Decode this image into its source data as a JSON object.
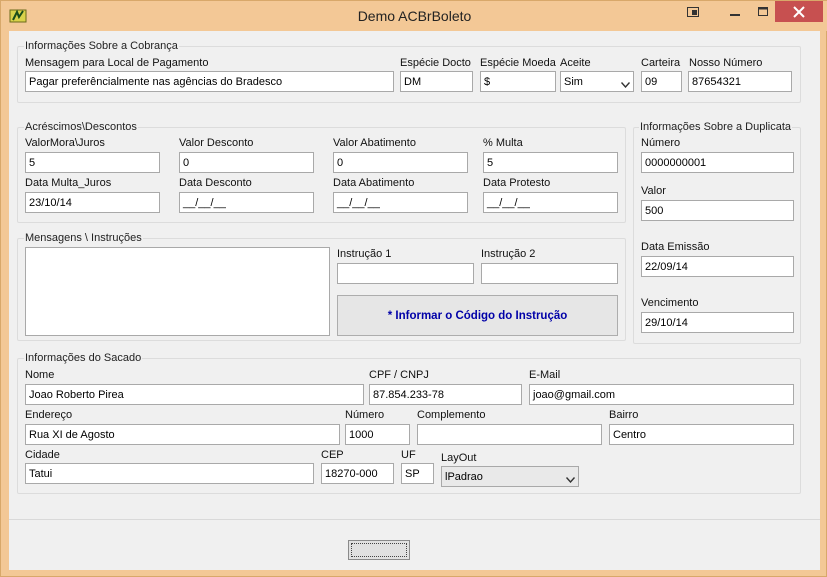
{
  "window": {
    "title": "Demo ACBrBoleto"
  },
  "cobranca": {
    "group_label": "Informações Sobre a Cobrança",
    "local_pagamento": {
      "label": "Mensagem para Local de Pagamento",
      "value": "Pagar preferêncialmente nas agências do Bradesco"
    },
    "especie_docto": {
      "label": "Espécie Docto",
      "value": "DM"
    },
    "especie_moeda": {
      "label": "Espécie Moeda",
      "value": "$"
    },
    "aceite": {
      "label": "Aceite",
      "value": "Sim"
    },
    "carteira": {
      "label": "Carteira",
      "value": "09"
    },
    "nosso_numero": {
      "label": "Nosso Número",
      "value": "87654321"
    }
  },
  "acrescimos": {
    "group_label": "Acréscimos\\Descontos",
    "valor_mora": {
      "label": "ValorMora\\Juros",
      "value": "5"
    },
    "valor_desconto": {
      "label": "Valor Desconto",
      "value": "0"
    },
    "valor_abatimento": {
      "label": "Valor Abatimento",
      "value": "0"
    },
    "multa": {
      "label": "% Multa",
      "value": "5"
    },
    "data_multa": {
      "label": "Data Multa_Juros",
      "value": "23/10/14"
    },
    "data_desconto": {
      "label": "Data Desconto",
      "value": "__/__/__"
    },
    "data_abatimento": {
      "label": "Data Abatimento",
      "value": "__/__/__"
    },
    "data_protesto": {
      "label": "Data Protesto",
      "value": "__/__/__"
    }
  },
  "mensagens": {
    "group_label": "Mensagens \\ Instruções",
    "memo_value": "",
    "instrucao1": {
      "label": "Instrução 1",
      "value": ""
    },
    "instrucao2": {
      "label": "Instrução 2",
      "value": ""
    },
    "info_button": "* Informar o Código do Instrução"
  },
  "duplicata": {
    "group_label": "Informações Sobre a Duplicata",
    "numero": {
      "label": "Número",
      "value": "0000000001"
    },
    "valor": {
      "label": "Valor",
      "value": "500"
    },
    "data_emissao": {
      "label": "Data Emissão",
      "value": "22/09/14"
    },
    "vencimento": {
      "label": "Vencimento",
      "value": "29/10/14"
    }
  },
  "sacado": {
    "group_label": "Informações do Sacado",
    "nome": {
      "label": "Nome",
      "value": "Joao Roberto Pirea"
    },
    "cpf": {
      "label": "CPF / CNPJ",
      "value": "87.854.233-78"
    },
    "email": {
      "label": "E-Mail",
      "value": "joao@gmail.com"
    },
    "endereco": {
      "label": "Endereço",
      "value": "Rua XI de Agosto"
    },
    "numero": {
      "label": "Número",
      "value": "1000"
    },
    "complemento": {
      "label": "Complemento",
      "value": ""
    },
    "bairro": {
      "label": "Bairro",
      "value": "Centro"
    },
    "cidade": {
      "label": "Cidade",
      "value": "Tatui"
    },
    "cep": {
      "label": "CEP",
      "value": "18270-000"
    },
    "uf": {
      "label": "UF",
      "value": "SP"
    },
    "layout": {
      "label": "LayOut",
      "value": "lPadrao"
    }
  },
  "bottom": {
    "button_label": ""
  }
}
